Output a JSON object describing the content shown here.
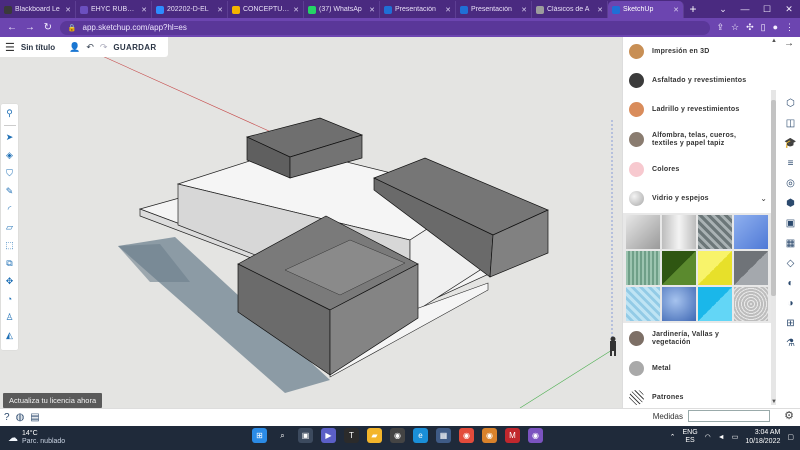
{
  "browser": {
    "tabs": [
      {
        "title": "Blackboard Le",
        "color": "#3a3a3a",
        "active": false
      },
      {
        "title": "EHYC RÚBRIC",
        "color": "#6b4fbf",
        "active": false
      },
      {
        "title": "202202-D-EL",
        "color": "#2d8cff",
        "active": false
      },
      {
        "title": "CONCEPTUAL",
        "color": "#f4b400",
        "active": false
      },
      {
        "title": "(37) WhatsAp",
        "color": "#25d366",
        "active": false
      },
      {
        "title": "Presentación",
        "color": "#1f6fd6",
        "active": false
      },
      {
        "title": "Presentación",
        "color": "#1f6fd6",
        "active": false
      },
      {
        "title": "Clásicos de A",
        "color": "#9c9c9c",
        "active": false
      },
      {
        "title": "SketchUp",
        "color": "#1f6fd6",
        "active": true
      }
    ],
    "new_tab": "+",
    "window_controls": [
      "⌄",
      "—",
      "☐",
      "✕"
    ],
    "url": "app.sketchup.com/app?hl=es"
  },
  "app": {
    "menu_icon": "menu-icon",
    "title": "Sin título",
    "save_label": "GUARDAR",
    "license_banner": "Actualiza tu licencia ahora",
    "measurements_label": "Medidas"
  },
  "materials": {
    "items_top": [
      {
        "label": "Impresión en 3D",
        "color": "#c88f55"
      },
      {
        "label": "Asfaltado y revestimientos",
        "color": "#3b3b3b"
      },
      {
        "label": "Ladrillo y revestimientos",
        "color": "#d98c5b"
      },
      {
        "label": "Alfombra, telas, cueros, textiles y papel tapiz",
        "color": "#8a7c70"
      },
      {
        "label": "Colores",
        "color": "#f7c9cf"
      },
      {
        "label": "Vidrio y espejos",
        "color": "#c8c8c8"
      }
    ],
    "swatches": [
      "#b8b8b8",
      "#dcdcdc",
      "#7f8a8c",
      "#6f93e6",
      "#8fb7a3",
      "#3f6a1e",
      "#f6f247",
      "#8f9398",
      "#a7d7ef",
      "#5f87c9",
      "#2fc2ec",
      "#d5d5d5"
    ],
    "items_bottom": [
      {
        "label": "Jardinería, Vallas y vegetación",
        "color": "#7d6f66"
      },
      {
        "label": "Metal",
        "color": "#a9a9a9"
      },
      {
        "label": "Patrones",
        "color": "#ffffff"
      }
    ]
  },
  "taskbar": {
    "temperature": "14°C",
    "weather": "Parc. nublado",
    "lang_top": "ENG",
    "lang_bottom": "ES",
    "time": "3:04 AM",
    "date": "10/18/2022"
  }
}
